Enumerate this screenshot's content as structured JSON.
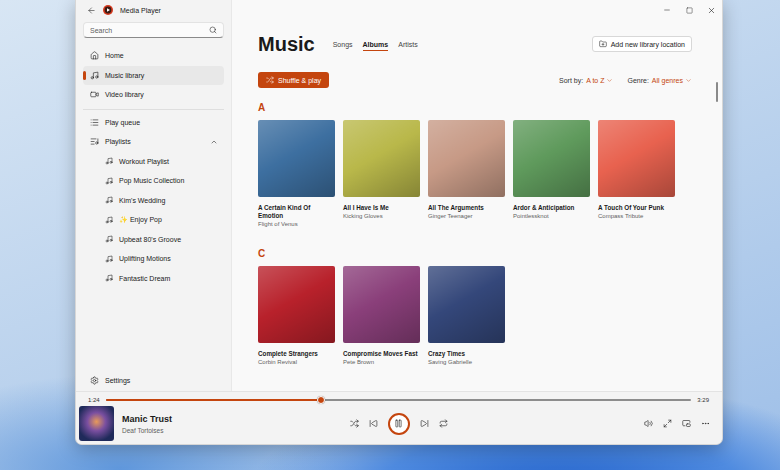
{
  "window": {
    "title": "Media Player"
  },
  "sidebar": {
    "search": {
      "placeholder": "Search"
    },
    "nav": [
      {
        "label": "Home",
        "selected": false
      },
      {
        "label": "Music library",
        "selected": true
      },
      {
        "label": "Video library",
        "selected": false
      }
    ],
    "queue": {
      "label": "Play queue",
      "selected": false
    },
    "playlists": {
      "label": "Playlists",
      "expanded": true,
      "items": [
        {
          "label": "Workout Playlist",
          "selected": false
        },
        {
          "label": "Pop Music Collection",
          "selected": false
        },
        {
          "label": "Kim's Wedding",
          "selected": false
        },
        {
          "label": "✨ Enjoy Pop",
          "selected": false
        },
        {
          "label": "Upbeat 80's Groove",
          "selected": false
        },
        {
          "label": "Uplifting Motions",
          "selected": false
        },
        {
          "label": "Fantastic Dream",
          "selected": false
        }
      ]
    },
    "settings": {
      "label": "Settings"
    }
  },
  "library": {
    "title": "Music",
    "tabs": [
      {
        "label": "Songs",
        "selected": false
      },
      {
        "label": "Albums",
        "selected": true
      },
      {
        "label": "Artists",
        "selected": false
      }
    ],
    "add_location": "Add new library location",
    "shuffle_play": "Shuffle & play",
    "sort": {
      "label": "Sort by:",
      "value": "A to Z"
    },
    "genre": {
      "label": "Genre:",
      "value": "All genres"
    },
    "sections": [
      {
        "letter": "A",
        "albums": [
          {
            "title": "A Certain Kind Of Emotion",
            "artist": "Flight of Venus",
            "color": "#3d6fa0"
          },
          {
            "title": "All I Have Is Me",
            "artist": "Kicking Gloves",
            "color": "#b9b84a"
          },
          {
            "title": "All The Arguments",
            "artist": "Ginger Teenager",
            "color": "#c79a86"
          },
          {
            "title": "Ardor & Anticipation",
            "artist": "Pointlessknot",
            "color": "#5f9a5c"
          },
          {
            "title": "A Touch Of Your Punk",
            "artist": "Compass Tribute",
            "color": "#e8624f"
          }
        ]
      },
      {
        "letter": "C",
        "albums": [
          {
            "title": "Complete Strangers",
            "artist": "Corbin Revival",
            "color": "#b8212b"
          },
          {
            "title": "Compromise Moves Fast",
            "artist": "Pete Brown",
            "color": "#8a3f7a"
          },
          {
            "title": "Crazy Times",
            "artist": "Saving Gabrielle",
            "color": "#34477a"
          }
        ]
      }
    ]
  },
  "player": {
    "elapsed": "1:24",
    "duration": "3:29",
    "level": 0.368,
    "track": "Manic Trust",
    "artist": "Deaf Tortoises",
    "playing": true
  }
}
